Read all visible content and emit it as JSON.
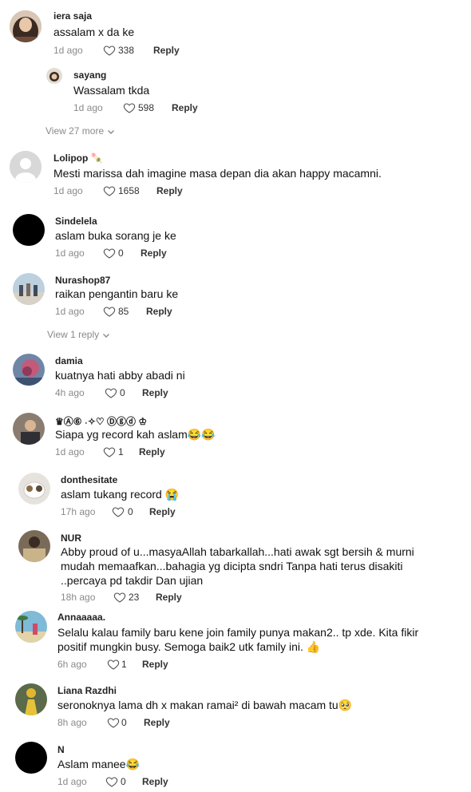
{
  "comments": [
    {
      "username": "iera saja",
      "text": "assalam x da ke",
      "time": "1d ago",
      "likes": "338",
      "reply": "Reply"
    },
    {
      "username": "sayang",
      "text": "Wassalam tkda",
      "time": "1d ago",
      "likes": "598",
      "reply": "Reply"
    },
    {
      "username": "Lolipop 🍡",
      "text": "Mesti marissa dah imagine masa depan dia akan happy macamni.",
      "time": "1d ago",
      "likes": "1658",
      "reply": "Reply"
    },
    {
      "username": "Sindelela",
      "text": "aslam buka sorang je ke",
      "time": "1d ago",
      "likes": "0",
      "reply": "Reply"
    },
    {
      "username": "Nurashop87",
      "text": "raikan pengantin baru ke",
      "time": "1d ago",
      "likes": "85",
      "reply": "Reply"
    },
    {
      "username": "damia",
      "text": "kuatnya hati abby abadi ni",
      "time": "4h ago",
      "likes": "0",
      "reply": "Reply"
    },
    {
      "username": "♛Ⓐ⑥ ˖✧♡ Ⓓⓖⓓ ♔",
      "text": "Siapa yg record kah aslam😂😂",
      "time": "1d ago",
      "likes": "1",
      "reply": "Reply"
    },
    {
      "username": "donthesitate",
      "text": "aslam tukang record 😭",
      "time": "17h ago",
      "likes": "0",
      "reply": "Reply"
    },
    {
      "username": "NUR",
      "text_lines": [
        "Abby proud of u...masyaAllah tabarkallah...hati awak sgt bersih & murni",
        "mudah memaafkan...bahagia yg dicipta sndri Tanpa hati terus disakiti",
        "..percaya pd takdir Dan ujian"
      ],
      "time": "18h ago",
      "likes": "23",
      "reply": "Reply"
    },
    {
      "username": "Annaaaaa.",
      "text_lines": [
        "Selalu kalau family baru kene join family punya makan2.. tp xde. Kita fikir",
        "positif mungkin busy. Semoga baik2 utk family ini. 👍"
      ],
      "time": "6h ago",
      "likes": "1",
      "reply": "Reply"
    },
    {
      "username": "Liana Razdhi",
      "text": "seronoknya lama dh x makan ramai² di bawah macam tu🥺",
      "time": "8h ago",
      "likes": "0",
      "reply": "Reply"
    },
    {
      "username": "N",
      "text": "Aslam manee😂",
      "time": "1d ago",
      "likes": "0",
      "reply": "Reply"
    }
  ],
  "view_more": [
    {
      "label": "View 27 more"
    },
    {
      "label": "View 1 reply"
    }
  ],
  "icons": {
    "like": "heart-outline-icon",
    "expand": "chevron-down-icon"
  },
  "colors": {
    "muted": "#8a8a8a",
    "text": "#111111",
    "background": "#ffffff"
  }
}
